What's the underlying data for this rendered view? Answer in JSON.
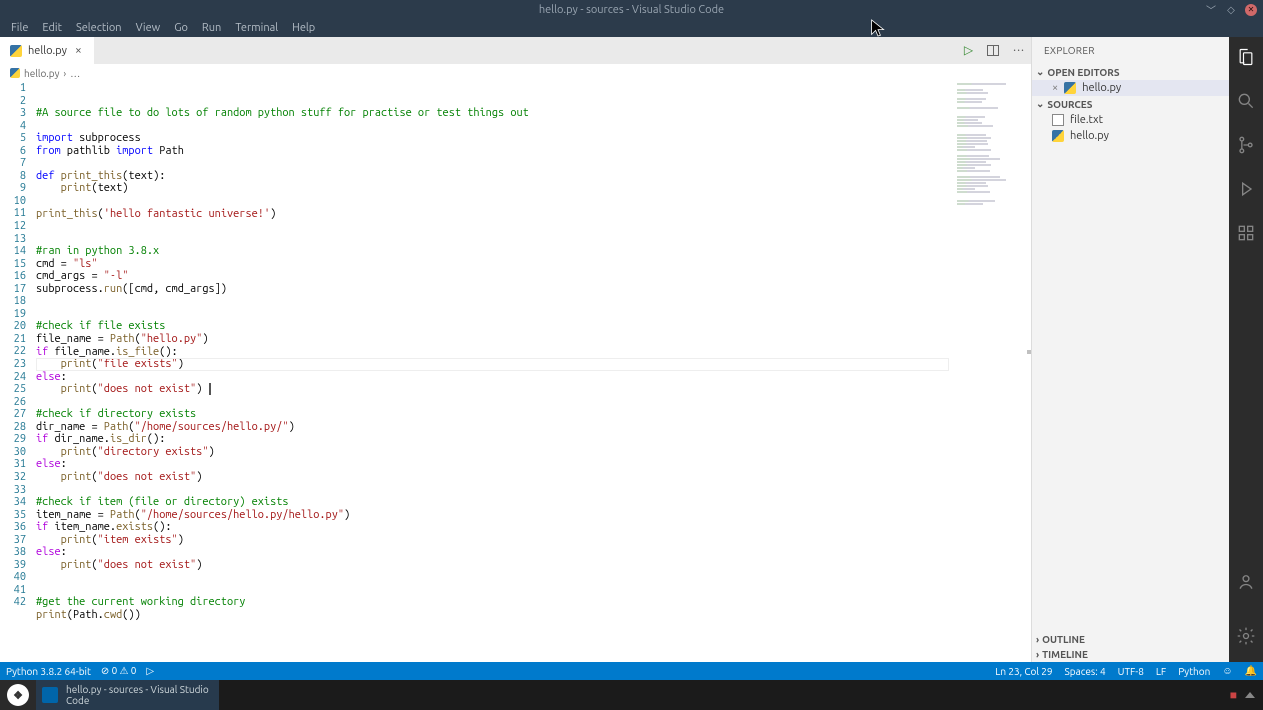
{
  "window": {
    "title": "hello.py - sources - Visual Studio Code"
  },
  "menubar": [
    "File",
    "Edit",
    "Selection",
    "View",
    "Go",
    "Run",
    "Terminal",
    "Help"
  ],
  "tabs": [
    {
      "label": "hello.py"
    }
  ],
  "breadcrumb": {
    "file": "hello.py",
    "more": "…"
  },
  "code": {
    "lines": [
      [
        [
          "comment",
          "#A source file to do lots of random python stuff for practise or test things out"
        ]
      ],
      [],
      [
        [
          "kw",
          "import"
        ],
        [
          "plain",
          " subprocess"
        ]
      ],
      [
        [
          "kw",
          "from"
        ],
        [
          "plain",
          " pathlib "
        ],
        [
          "kw",
          "import"
        ],
        [
          "plain",
          " Path"
        ]
      ],
      [],
      [
        [
          "kw",
          "def"
        ],
        [
          "plain",
          " "
        ],
        [
          "fn",
          "print_this"
        ],
        [
          "plain",
          "(text):"
        ]
      ],
      [
        [
          "plain",
          "    "
        ],
        [
          "fn",
          "print"
        ],
        [
          "plain",
          "(text)"
        ]
      ],
      [],
      [
        [
          "fn",
          "print_this"
        ],
        [
          "plain",
          "("
        ],
        [
          "str",
          "'hello fantastic universe!'"
        ],
        [
          "plain",
          ")"
        ]
      ],
      [],
      [],
      [
        [
          "comment",
          "#ran in python 3.8.x"
        ]
      ],
      [
        [
          "plain",
          "cmd = "
        ],
        [
          "str",
          "\"ls\""
        ]
      ],
      [
        [
          "plain",
          "cmd_args = "
        ],
        [
          "str",
          "\"-l\""
        ]
      ],
      [
        [
          "plain",
          "subprocess."
        ],
        [
          "fn",
          "run"
        ],
        [
          "plain",
          "([cmd, cmd_args])"
        ]
      ],
      [],
      [],
      [
        [
          "comment",
          "#check if file exists"
        ]
      ],
      [
        [
          "plain",
          "file_name = "
        ],
        [
          "fn",
          "Path"
        ],
        [
          "plain",
          "("
        ],
        [
          "str",
          "\"hello.py\""
        ],
        [
          "plain",
          ")"
        ]
      ],
      [
        [
          "ctrl",
          "if"
        ],
        [
          "plain",
          " file_name."
        ],
        [
          "fn",
          "is_file"
        ],
        [
          "plain",
          "():"
        ]
      ],
      [
        [
          "plain",
          "    "
        ],
        [
          "fn",
          "print"
        ],
        [
          "plain",
          "("
        ],
        [
          "str",
          "\"file exists\""
        ],
        [
          "plain",
          ")"
        ]
      ],
      [
        [
          "ctrl",
          "else"
        ],
        [
          "plain",
          ":"
        ]
      ],
      [
        [
          "plain",
          "    "
        ],
        [
          "fn",
          "print"
        ],
        [
          "plain",
          "("
        ],
        [
          "str",
          "\"does not exist\""
        ],
        [
          "plain",
          ") "
        ]
      ],
      [],
      [
        [
          "comment",
          "#check if directory exists"
        ]
      ],
      [
        [
          "plain",
          "dir_name = "
        ],
        [
          "fn",
          "Path"
        ],
        [
          "plain",
          "("
        ],
        [
          "str",
          "\"/home/sources/hello.py/\""
        ],
        [
          "plain",
          ")"
        ]
      ],
      [
        [
          "ctrl",
          "if"
        ],
        [
          "plain",
          " dir_name."
        ],
        [
          "fn",
          "is_dir"
        ],
        [
          "plain",
          "():"
        ]
      ],
      [
        [
          "plain",
          "    "
        ],
        [
          "fn",
          "print"
        ],
        [
          "plain",
          "("
        ],
        [
          "str",
          "\"directory exists\""
        ],
        [
          "plain",
          ")"
        ]
      ],
      [
        [
          "ctrl",
          "else"
        ],
        [
          "plain",
          ":"
        ]
      ],
      [
        [
          "plain",
          "    "
        ],
        [
          "fn",
          "print"
        ],
        [
          "plain",
          "("
        ],
        [
          "str",
          "\"does not exist\""
        ],
        [
          "plain",
          ")"
        ]
      ],
      [],
      [
        [
          "comment",
          "#check if item (file or directory) exists"
        ]
      ],
      [
        [
          "plain",
          "item_name = "
        ],
        [
          "fn",
          "Path"
        ],
        [
          "plain",
          "("
        ],
        [
          "str",
          "\"/home/sources/hello.py/hello.py\""
        ],
        [
          "plain",
          ")"
        ]
      ],
      [
        [
          "ctrl",
          "if"
        ],
        [
          "plain",
          " item_name."
        ],
        [
          "fn",
          "exists"
        ],
        [
          "plain",
          "():"
        ]
      ],
      [
        [
          "plain",
          "    "
        ],
        [
          "fn",
          "print"
        ],
        [
          "plain",
          "("
        ],
        [
          "str",
          "\"item exists\""
        ],
        [
          "plain",
          ")"
        ]
      ],
      [
        [
          "ctrl",
          "else"
        ],
        [
          "plain",
          ":"
        ]
      ],
      [
        [
          "plain",
          "    "
        ],
        [
          "fn",
          "print"
        ],
        [
          "plain",
          "("
        ],
        [
          "str",
          "\"does not exist\""
        ],
        [
          "plain",
          ")"
        ]
      ],
      [],
      [],
      [
        [
          "comment",
          "#get the current working directory"
        ]
      ],
      [
        [
          "fn",
          "print"
        ],
        [
          "plain",
          "(Path."
        ],
        [
          "fn",
          "cwd"
        ],
        [
          "plain",
          "())"
        ]
      ],
      []
    ],
    "cursor_line": 23
  },
  "explorer": {
    "title": "EXPLORER",
    "sections": {
      "open_editors": {
        "label": "OPEN EDITORS",
        "items": [
          {
            "kind": "py",
            "label": "hello.py"
          }
        ]
      },
      "sources": {
        "label": "SOURCES",
        "items": [
          {
            "kind": "txt",
            "label": "file.txt"
          },
          {
            "kind": "py",
            "label": "hello.py"
          }
        ]
      },
      "outline": {
        "label": "OUTLINE"
      },
      "timeline": {
        "label": "TIMELINE"
      }
    }
  },
  "statusbar": {
    "python": "Python 3.8.2 64-bit",
    "problems": "⊘ 0  ⚠ 0",
    "position": "Ln 23, Col 29",
    "spaces": "Spaces: 4",
    "encoding": "UTF-8",
    "eol": "LF",
    "lang": "Python",
    "feedback": "☺"
  },
  "taskbar": {
    "app_title_line1": "hello.py - sources - Visual Studio",
    "app_title_line2": "Code"
  }
}
